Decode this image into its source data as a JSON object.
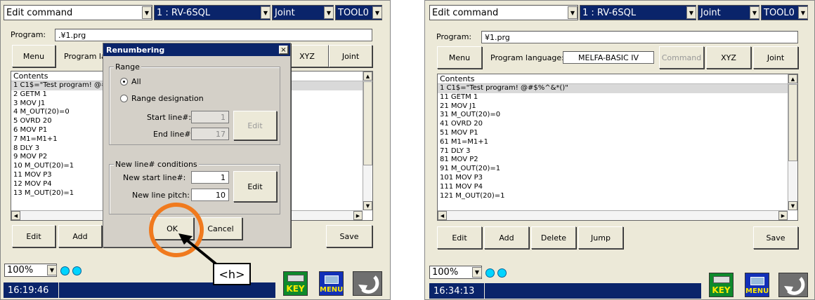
{
  "left": {
    "header": {
      "mode": "Edit command",
      "robot": "1 : RV-6SQL",
      "coord": "Joint",
      "tool": "TOOL0"
    },
    "program_label": "Program:",
    "program_value": ".¥1.prg",
    "menu_label": "Menu",
    "lang_label_partial": "Program la",
    "xyz_label": "XYZ",
    "joint_label": "Joint",
    "contents_header": "Contents",
    "lines": [
      "1 C1$=\"Test program! @#",
      "2 GETM 1",
      "3 MOV J1",
      "4 M_OUT(20)=0",
      "5 OVRD 20",
      "6 MOV P1",
      "7 M1=M1+1",
      "8 DLY 3",
      "9 MOV P2",
      "10 M_OUT(20)=1",
      "11 MOV P3",
      "12 MOV P4",
      "13 M_OUT(20)=1"
    ],
    "edit_label": "Edit",
    "add_label": "Add",
    "save_label": "Save",
    "zoom": "100%",
    "time": "16:19:46",
    "dialog": {
      "title": "Renumbering",
      "close": "×",
      "range_group": "Range",
      "all_label": "All",
      "range_designation": "Range designation",
      "start_line_label": "Start line#:",
      "start_line_value": "1",
      "end_line_label": "End line#:",
      "end_line_value": "17",
      "edit_disabled_label": "Edit",
      "new_cond_group": "New line# conditions",
      "new_start_label": "New start line#:",
      "new_start_value": "1",
      "new_pitch_label": "New line pitch:",
      "new_pitch_value": "10",
      "edit_label": "Edit",
      "ok_label": "OK",
      "cancel_label": "Cancel"
    },
    "callout": "<h>"
  },
  "right": {
    "header": {
      "mode": "Edit command",
      "robot": "1 : RV-6SQL",
      "coord": "Joint",
      "tool": "TOOL0"
    },
    "program_label": "Program:",
    "program_value": "¥1.prg",
    "menu_label": "Menu",
    "lang_label": "Program language:",
    "lang_value": "MELFA-BASIC IV",
    "command_label": "Command",
    "xyz_label": "XYZ",
    "joint_label": "Joint",
    "contents_header": "Contents",
    "lines": [
      "1 C1$=\"Test program! @#$%^&*()\"",
      "11 GETM 1",
      "21 MOV J1",
      "31 M_OUT(20)=0",
      "41 OVRD 20",
      "51 MOV P1",
      "61 M1=M1+1",
      "71 DLY 3",
      "81 MOV P2",
      "91 M_OUT(20)=1",
      "101 MOV P3",
      "111 MOV P4",
      "121 M_OUT(20)=1"
    ],
    "edit_label": "Edit",
    "add_label": "Add",
    "delete_label": "Delete",
    "jump_label": "Jump",
    "save_label": "Save",
    "zoom": "100%",
    "time": "16:34:13"
  },
  "icons": {
    "key": "KEY",
    "menu": "MENU"
  }
}
